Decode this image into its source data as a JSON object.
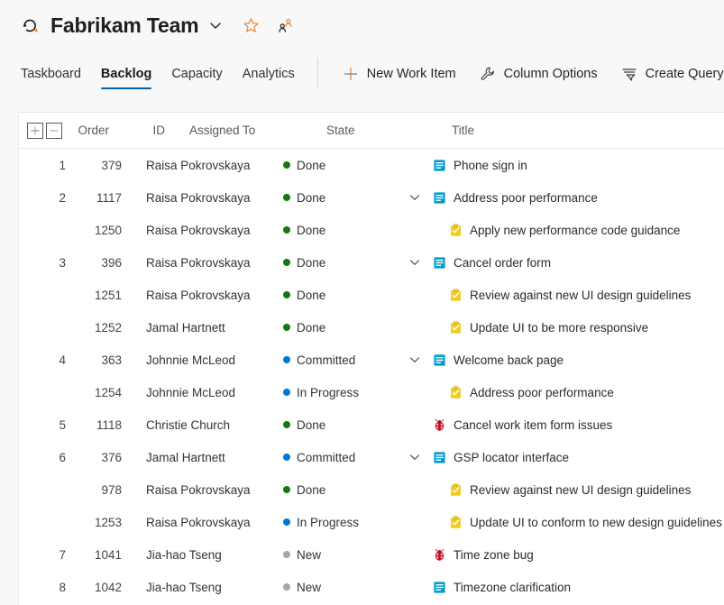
{
  "header": {
    "title": "Fabrikam Team",
    "logo_icon": "azure-devops-repo-icon",
    "chevron_icon": "chevron-down-icon",
    "favorite_icon": "star-favorite-icon",
    "team_members_icon": "people-team-icon"
  },
  "tabs": [
    {
      "label": "Taskboard",
      "active": false
    },
    {
      "label": "Backlog",
      "active": true
    },
    {
      "label": "Capacity",
      "active": false
    },
    {
      "label": "Analytics",
      "active": false
    }
  ],
  "toolbar": [
    {
      "label": "New Work Item",
      "icon": "plus-icon"
    },
    {
      "label": "Column Options",
      "icon": "wrench-icon"
    },
    {
      "label": "Create Query",
      "icon": "filter-query-icon"
    }
  ],
  "grid": {
    "expand_all_label": "+",
    "collapse_all_label": "–",
    "columns": {
      "order": "Order",
      "id": "ID",
      "assigned_to": "Assigned To",
      "state": "State",
      "title": "Title"
    },
    "state_colors": {
      "Done": "#107c10",
      "Committed": "#0078d4",
      "In Progress": "#0078d4",
      "New": "#a6a6a6"
    },
    "type_colors": {
      "product-backlog-item": "#009ccc",
      "task": "#f2cb1d",
      "bug": "#cc293d"
    },
    "rows": [
      {
        "order": "1",
        "id": "379",
        "assigned_to": "Raisa Pokrovskaya",
        "state": "Done",
        "title": "Phone sign in",
        "type": "product-backlog-item",
        "indent": 0,
        "expandable": false
      },
      {
        "order": "2",
        "id": "1117",
        "assigned_to": "Raisa Pokrovskaya",
        "state": "Done",
        "title": "Address poor performance",
        "type": "product-backlog-item",
        "indent": 0,
        "expandable": true
      },
      {
        "order": "",
        "id": "1250",
        "assigned_to": "Raisa Pokrovskaya",
        "state": "Done",
        "title": "Apply new performance code guidance",
        "type": "task",
        "indent": 1,
        "expandable": false
      },
      {
        "order": "3",
        "id": "396",
        "assigned_to": "Raisa Pokrovskaya",
        "state": "Done",
        "title": "Cancel order form",
        "type": "product-backlog-item",
        "indent": 0,
        "expandable": true
      },
      {
        "order": "",
        "id": "1251",
        "assigned_to": "Raisa Pokrovskaya",
        "state": "Done",
        "title": "Review against new UI design guidelines",
        "type": "task",
        "indent": 1,
        "expandable": false
      },
      {
        "order": "",
        "id": "1252",
        "assigned_to": "Jamal Hartnett",
        "state": "Done",
        "title": "Update UI to be more responsive",
        "type": "task",
        "indent": 1,
        "expandable": false
      },
      {
        "order": "4",
        "id": "363",
        "assigned_to": "Johnnie McLeod",
        "state": "Committed",
        "title": "Welcome back page",
        "type": "product-backlog-item",
        "indent": 0,
        "expandable": true
      },
      {
        "order": "",
        "id": "1254",
        "assigned_to": "Johnnie McLeod",
        "state": "In Progress",
        "title": "Address poor performance",
        "type": "task",
        "indent": 1,
        "expandable": false
      },
      {
        "order": "5",
        "id": "1118",
        "assigned_to": "Christie Church",
        "state": "Done",
        "title": "Cancel work item form issues",
        "type": "bug",
        "indent": 0,
        "expandable": false
      },
      {
        "order": "6",
        "id": "376",
        "assigned_to": "Jamal Hartnett",
        "state": "Committed",
        "title": "GSP locator interface",
        "type": "product-backlog-item",
        "indent": 0,
        "expandable": true
      },
      {
        "order": "",
        "id": "978",
        "assigned_to": "Raisa Pokrovskaya",
        "state": "Done",
        "title": "Review against new UI design guidelines",
        "type": "task",
        "indent": 1,
        "expandable": false
      },
      {
        "order": "",
        "id": "1253",
        "assigned_to": "Raisa Pokrovskaya",
        "state": "In Progress",
        "title": "Update UI to conform to new design guidelines",
        "type": "task",
        "indent": 1,
        "expandable": false
      },
      {
        "order": "7",
        "id": "1041",
        "assigned_to": "Jia-hao Tseng",
        "state": "New",
        "title": "Time zone bug",
        "type": "bug",
        "indent": 0,
        "expandable": false
      },
      {
        "order": "8",
        "id": "1042",
        "assigned_to": "Jia-hao Tseng",
        "state": "New",
        "title": "Timezone clarification",
        "type": "product-backlog-item",
        "indent": 0,
        "expandable": false
      }
    ]
  }
}
